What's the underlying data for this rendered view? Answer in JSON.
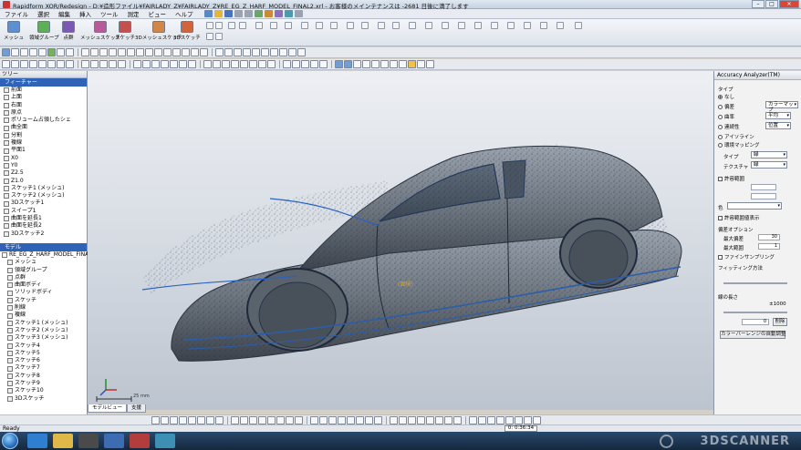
{
  "window": {
    "title": "Rapidform XOR/Redesign - D:¥造形ファイル¥FAIRLADY_Z¥FAIRLADY_Z¥RE_EG_Z_HARF_MODEL_FINAL2.xrl - お客様のメインテナンスは -2681 日後に満了します"
  },
  "menu": [
    "ファイル",
    "選択",
    "編集",
    "挿入",
    "ツール",
    "測定",
    "ビュー",
    "ヘルプ"
  ],
  "ribbon": {
    "buttons": [
      "メッシュ",
      "領域グループ",
      "点群",
      "メッシュスケッチ",
      "スケッチ",
      "3Dメッシュスケッチ",
      "3Dスケッチ"
    ]
  },
  "tree": {
    "header": "ツリー",
    "feature_header": "フィーチャー",
    "features": [
      "前面",
      "上面",
      "右面",
      "原点",
      "ポリューム占領したシェ",
      "曲全面",
      "分割",
      "複線",
      "平面1",
      "X0",
      "Y0",
      "Z2.5",
      "Z1.0",
      "スケッチ1 (メッシュ)",
      "スケッチ2 (メッシュ)",
      "3Dスケッチ1",
      "スイープ1",
      "曲面を延長1",
      "曲面を延長2",
      "3Dスケッチ2"
    ],
    "model_header": "モデル",
    "model_root": "RE_EG_Z_HARF_MODEL_FINAL2",
    "model_items": [
      "メッシュ",
      "領域グループ",
      "点群",
      "曲面ボディ",
      "ソリッドボディ",
      "スケッチ",
      "削線",
      "複線",
      "スケッチ1 (メッシュ)",
      "スケッチ2 (メッシュ)",
      "スケッチ3 (メッシュ)",
      "スケッチ4",
      "スケッチ5",
      "スケッチ6",
      "スケッチ7",
      "スケッチ8",
      "スケッチ9",
      "スケッチ10",
      "3Dスケッチ"
    ]
  },
  "viewport": {
    "annotation": "(面積)",
    "scale_label": "25 mm",
    "tabs": [
      "モデルビュー",
      "支援"
    ]
  },
  "right_panel": {
    "title": "Accuracy Analyzer(TM)",
    "type_label": "タイプ",
    "options": [
      "なし",
      "偏差",
      "曲率",
      "連続性",
      "アイソライン",
      "環境マッピング"
    ],
    "deviation_value": "カラーマップ",
    "curvature_value": "平均",
    "continuity_value": "位置",
    "tipo_label": "タイプ",
    "tipo_value": "緑",
    "texture_label": "テクスチャ",
    "texture_value": "緑",
    "allow_range": "許容範囲",
    "color_label": "色",
    "show_allow": "許容範囲値表示",
    "options_header": "偏差オプション",
    "max_dev_label": "最大偏差",
    "max_dev_value": "30",
    "max_range_label": "最大範囲",
    "max_range_value": "1",
    "fine_sampling": "ファインサンプリング",
    "fitting_header": "フィッティング方法",
    "line_count_header": "線の長さ",
    "slider_value": "±1000",
    "num_field": "0",
    "apply_btn": "削除",
    "bottom_btn": "カラーバーレンジの自動調整"
  },
  "status": {
    "text": "Ready",
    "coords": "0: 0:36:34"
  },
  "taskbar": {
    "watermark": "3DSCANNER"
  }
}
